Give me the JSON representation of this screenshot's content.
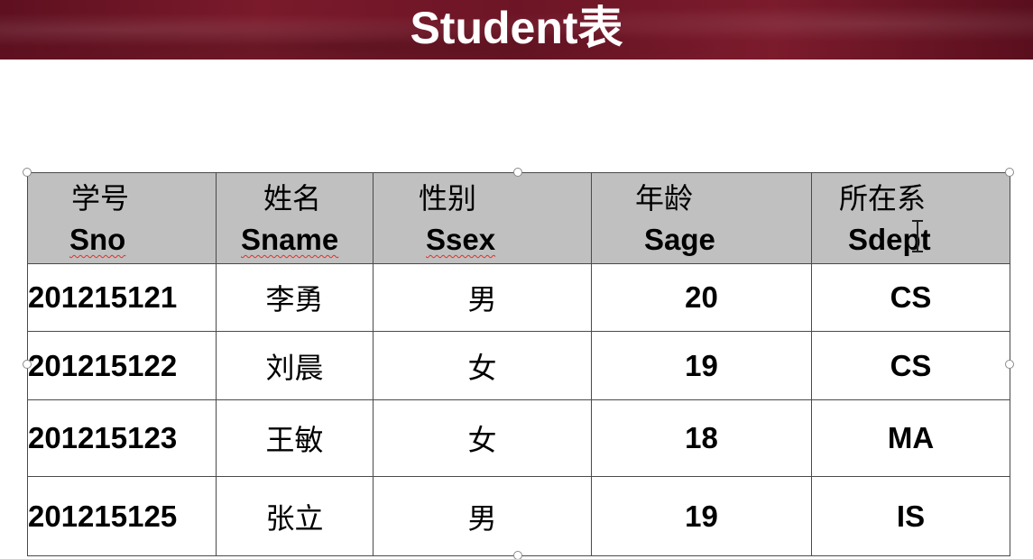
{
  "slide": {
    "title": "Student表"
  },
  "table": {
    "headers": [
      {
        "cn": "学号",
        "en": "Sno"
      },
      {
        "cn": "姓名",
        "en": "Sname"
      },
      {
        "cn": "性别",
        "en": "Ssex"
      },
      {
        "cn": "年龄",
        "en": "Sage"
      },
      {
        "cn": "所在系",
        "en": "Sdept"
      }
    ],
    "rows": [
      {
        "sno": "201215121",
        "sname": "李勇",
        "ssex": "男",
        "sage": "20",
        "sdept": "CS"
      },
      {
        "sno": "201215122",
        "sname": "刘晨",
        "ssex": "女",
        "sage": "19",
        "sdept": "CS"
      },
      {
        "sno": "201215123",
        "sname": "王敏",
        "ssex": "女",
        "sage": "18",
        "sdept": "MA"
      },
      {
        "sno": "201215125",
        "sname": "张立",
        "ssex": "男",
        "sage": "19",
        "sdept": "IS"
      }
    ]
  },
  "colors": {
    "title_bar": "#6d1526",
    "title_text": "#ffffff",
    "header_fill": "#c0c0c0",
    "border": "#4a4a4a",
    "spellcheck_underline": "#e0302a"
  },
  "icons": {
    "cursor": "text-cursor-icon",
    "handles": "resize-handle-icon"
  }
}
